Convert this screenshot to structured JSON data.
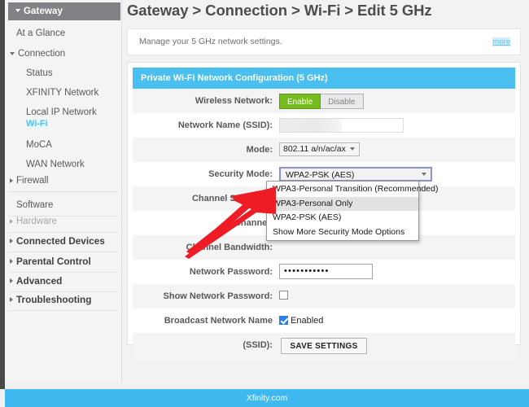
{
  "sidebar": {
    "header": "Gateway",
    "items": [
      {
        "label": "At a Glance",
        "level": 1,
        "style": "plain",
        "caret": "none"
      },
      {
        "label": "Connection",
        "level": 0,
        "style": "plain",
        "caret": "down"
      },
      {
        "label": "Status",
        "level": 2,
        "style": "plain",
        "caret": "none"
      },
      {
        "label": "XFINITY Network",
        "level": 2,
        "style": "plain",
        "caret": "none"
      },
      {
        "label": "Local IP Network",
        "level": 2,
        "style": "plain",
        "caret": "none"
      },
      {
        "label": "Wi-Fi",
        "level": 2,
        "style": "active",
        "caret": "none"
      },
      {
        "label": "MoCA",
        "level": 2,
        "style": "plain",
        "caret": "none"
      },
      {
        "label": "WAN Network",
        "level": 2,
        "style": "plain",
        "caret": "none"
      },
      {
        "label": "Firewall",
        "level": 0,
        "style": "plain",
        "caret": "right"
      },
      {
        "label": "Software",
        "level": 1,
        "style": "plain",
        "caret": "none"
      },
      {
        "label": "Hardware",
        "level": 0,
        "style": "faint",
        "caret": "right-faint"
      },
      {
        "label": "Connected Devices",
        "level": 0,
        "style": "bold",
        "caret": "right"
      },
      {
        "label": "Parental Control",
        "level": 0,
        "style": "bold",
        "caret": "right"
      },
      {
        "label": "Advanced",
        "level": 0,
        "style": "bold",
        "caret": "right"
      },
      {
        "label": "Troubleshooting",
        "level": 0,
        "style": "bold",
        "caret": "right"
      }
    ]
  },
  "header": {
    "title": "Gateway > Connection > Wi-Fi > Edit 5 GHz"
  },
  "notice": {
    "text": "Manage your 5 GHz network settings.",
    "more_label": "more"
  },
  "panel": {
    "title": "Private Wi-Fi Network Configuration (5 GHz)",
    "rows": {
      "wireless_network": {
        "label": "Wireless Network:",
        "enable_label": "Enable",
        "disable_label": "Disable"
      },
      "ssid": {
        "label": "Network Name (SSID):",
        "value": ""
      },
      "mode": {
        "label": "Mode:",
        "value": "802.11 a/n/ac/ax"
      },
      "security_mode": {
        "label": "Security Mode:",
        "value": "WPA2-PSK (AES)",
        "options": [
          "WPA3-Personal Transition (Recommended)",
          "WPA3-Personal Only",
          "WPA2-PSK (AES)",
          "Show More Security Mode Options"
        ],
        "highlighted_option": "WPA3-Personal Only"
      },
      "channel_selection": {
        "label": "Channel Selection:"
      },
      "channel": {
        "label": "Channel:"
      },
      "channel_bandwidth": {
        "label": "Channel Bandwidth:"
      },
      "network_password": {
        "label": "Network Password:",
        "value": "???????????"
      },
      "show_network_password": {
        "label": "Show Network Password:",
        "checked": false
      },
      "broadcast_ssid": {
        "label": "Broadcast Network Name (SSID):",
        "checkbox_label": "Enabled",
        "checked": true
      }
    },
    "save_label": "SAVE SETTINGS"
  },
  "footer": {
    "text": "Xfinity.com"
  },
  "colors": {
    "accent_blue": "#49c0f0",
    "enable_green": "#76bc21",
    "sidebar_header_gray": "#808285",
    "arrow_red": "#ee1c25",
    "checkbox_blue": "#2a7fe8"
  }
}
